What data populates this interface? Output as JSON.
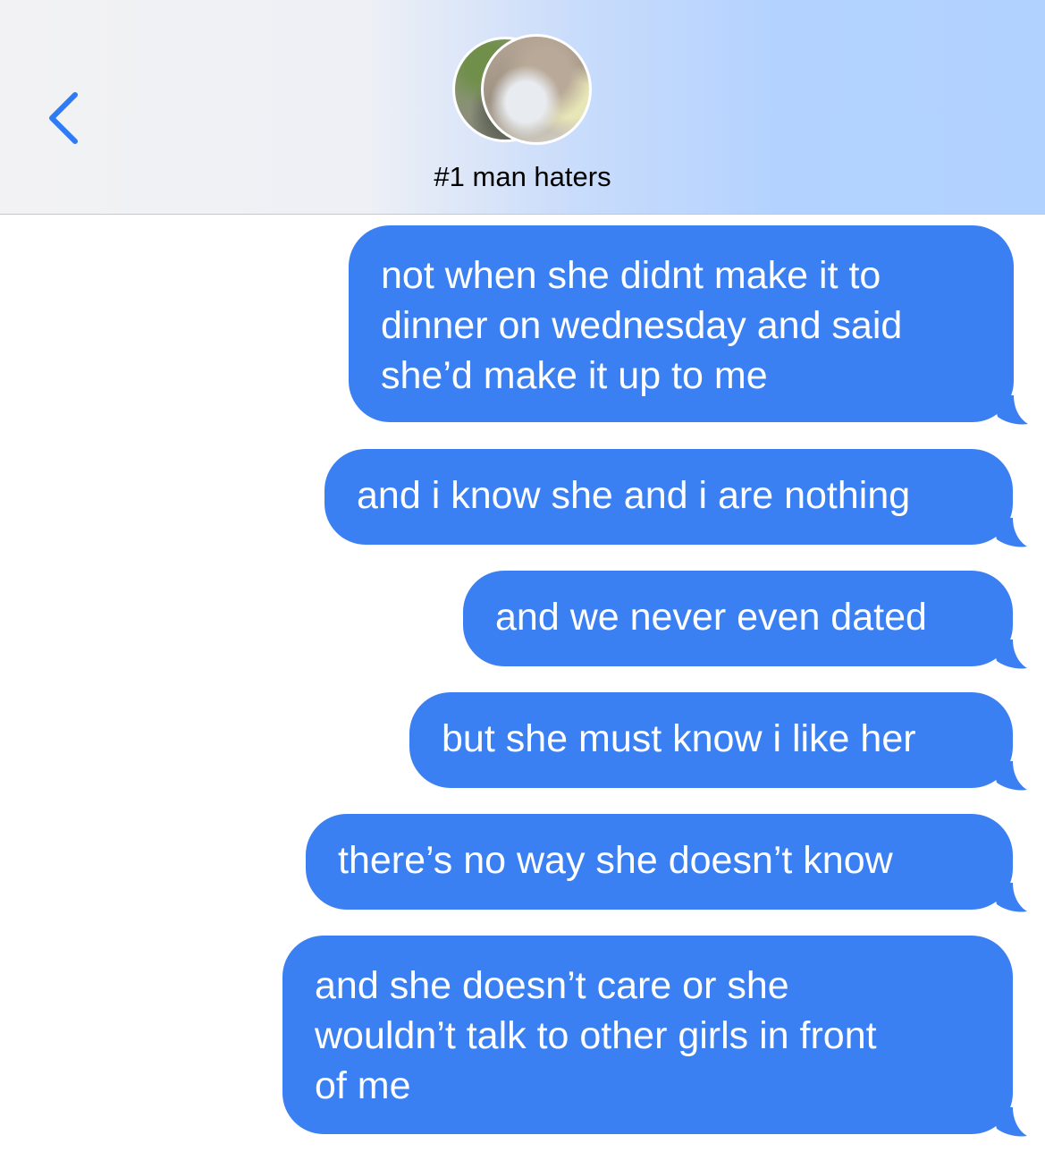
{
  "header": {
    "back_icon": "chevron-left-icon",
    "title": "#1 man haters",
    "avatars": [
      "group-avatar-1",
      "group-avatar-2"
    ]
  },
  "colors": {
    "bubble_blue": "#3b80f3",
    "back_blue": "#2f7bf5"
  },
  "messages": [
    {
      "text": "not when she didnt make it to\ndinner on wednesday and said\nshe’d make it up to me"
    },
    {
      "text": "and i know she and i are nothing"
    },
    {
      "text": "and we never even dated"
    },
    {
      "text": "but she must know i like her"
    },
    {
      "text": "there’s no way she doesn’t know"
    },
    {
      "text": "and she doesn’t care or she\nwouldn’t talk to other girls in front\nof me"
    }
  ]
}
